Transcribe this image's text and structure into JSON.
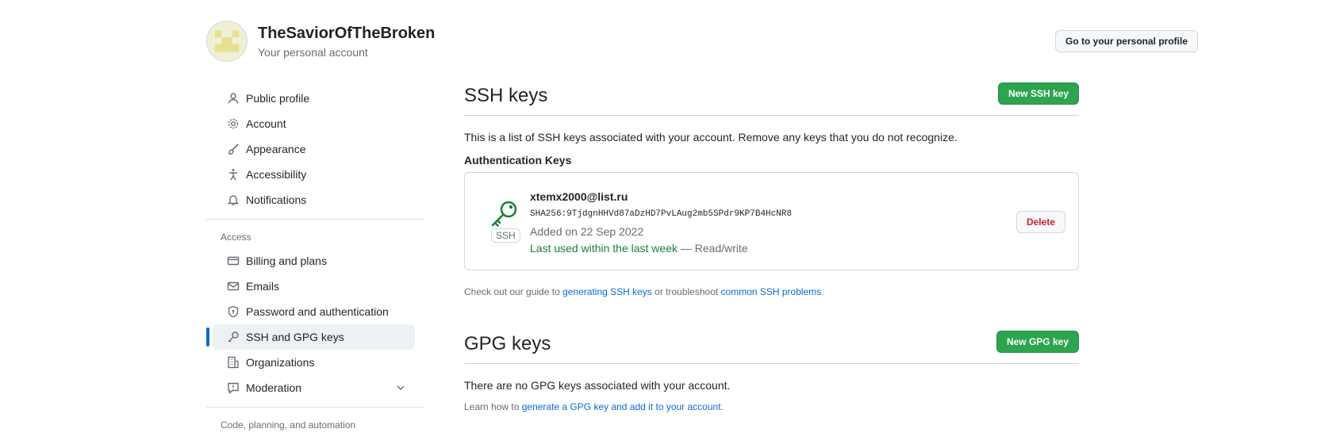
{
  "header": {
    "username": "TheSaviorOfTheBroken",
    "subtitle": "Your personal account",
    "profile_button": "Go to your personal profile"
  },
  "sidebar": {
    "group1": [
      {
        "label": "Public profile",
        "icon": "person-icon"
      },
      {
        "label": "Account",
        "icon": "gear-icon"
      },
      {
        "label": "Appearance",
        "icon": "paintbrush-icon"
      },
      {
        "label": "Accessibility",
        "icon": "accessibility-icon"
      },
      {
        "label": "Notifications",
        "icon": "bell-icon"
      }
    ],
    "access_heading": "Access",
    "group2": [
      {
        "label": "Billing and plans",
        "icon": "credit-card-icon"
      },
      {
        "label": "Emails",
        "icon": "mail-icon"
      },
      {
        "label": "Password and authentication",
        "icon": "shield-lock-icon"
      },
      {
        "label": "SSH and GPG keys",
        "icon": "key-icon",
        "active": true
      },
      {
        "label": "Organizations",
        "icon": "organization-icon"
      },
      {
        "label": "Moderation",
        "icon": "report-icon"
      }
    ],
    "code_heading": "Code, planning, and automation"
  },
  "ssh": {
    "title": "SSH keys",
    "new_button": "New SSH key",
    "description": "This is a list of SSH keys associated with your account. Remove any keys that you do not recognize.",
    "auth_heading": "Authentication Keys",
    "key": {
      "badge": "SSH",
      "email": "xtemx2000@list.ru",
      "fingerprint": "SHA256:9TjdgnHHVd87aDzHD7PvLAug2mb5SPdr9KP7B4HcNR8",
      "added": "Added on 22 Sep 2022",
      "last_used": "Last used within the last week",
      "access": " — Read/write",
      "delete_button": "Delete"
    },
    "guide_prefix": "Check out our guide to ",
    "guide_link1": "generating SSH keys",
    "guide_mid": " or troubleshoot ",
    "guide_link2": "common SSH problems",
    "guide_suffix": "."
  },
  "gpg": {
    "title": "GPG keys",
    "new_button": "New GPG key",
    "none_text": "There are no GPG keys associated with your account.",
    "learn_prefix": "Learn how to ",
    "learn_link": "generate a GPG key and add it to your account",
    "learn_suffix": "."
  },
  "colors": {
    "accent": "#0969da",
    "primary_button": "#2da44e",
    "success_text": "#1a7f37",
    "danger_text": "#cf222e"
  }
}
